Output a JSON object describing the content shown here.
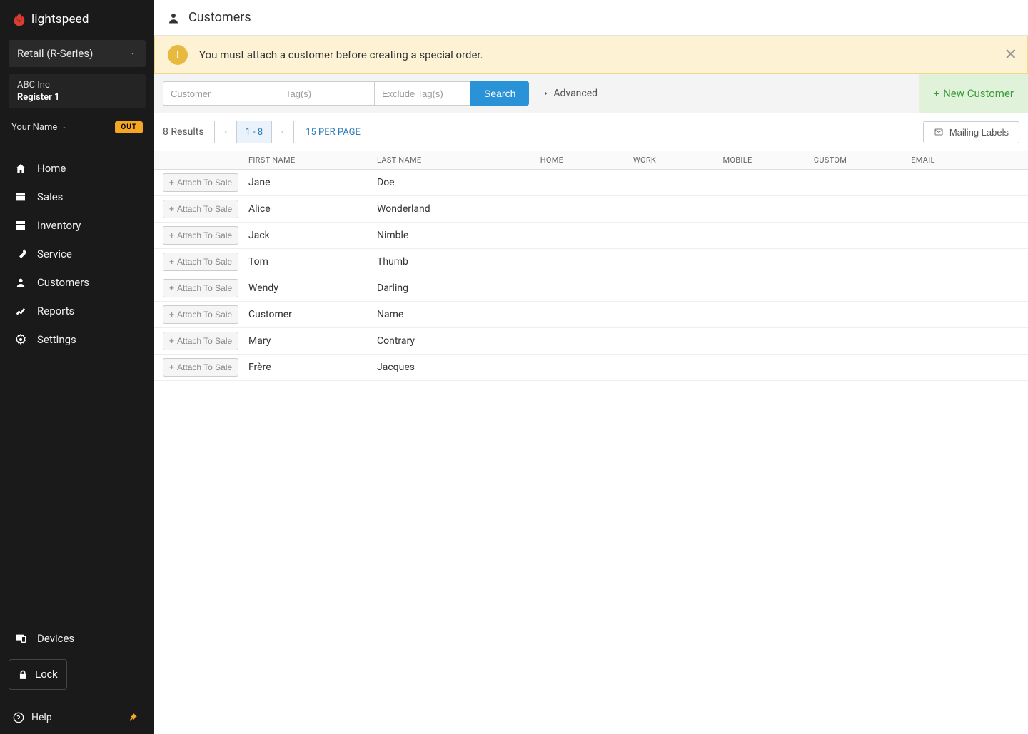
{
  "brand": "lightspeed",
  "sidebar": {
    "retail_label": "Retail (R-Series)",
    "company": "ABC Inc",
    "register": "Register 1",
    "user_name": "Your Name",
    "out_badge": "OUT",
    "nav": [
      {
        "label": "Home",
        "icon": "home"
      },
      {
        "label": "Sales",
        "icon": "sales"
      },
      {
        "label": "Inventory",
        "icon": "inventory"
      },
      {
        "label": "Service",
        "icon": "service"
      },
      {
        "label": "Customers",
        "icon": "customers"
      },
      {
        "label": "Reports",
        "icon": "reports"
      },
      {
        "label": "Settings",
        "icon": "settings"
      }
    ],
    "devices_label": "Devices",
    "lock_label": "Lock",
    "help_label": "Help"
  },
  "page": {
    "title": "Customers",
    "alert_text": "You must attach a customer before creating a special order."
  },
  "filters": {
    "customer_placeholder": "Customer",
    "tags_placeholder": "Tag(s)",
    "exclude_tags_placeholder": "Exclude Tag(s)",
    "search_label": "Search",
    "advanced_label": "Advanced",
    "new_customer_label": "New Customer"
  },
  "pagination": {
    "results_text": "8 Results",
    "range_text": "1 - 8",
    "per_page_text": "15 PER PAGE",
    "mailing_labels_text": "Mailing Labels"
  },
  "table": {
    "attach_label": "Attach To Sale",
    "columns": [
      "",
      "FIRST NAME",
      "LAST NAME",
      "HOME",
      "WORK",
      "MOBILE",
      "CUSTOM",
      "EMAIL"
    ],
    "rows": [
      {
        "first": "Jane",
        "last": "Doe"
      },
      {
        "first": "Alice",
        "last": "Wonderland"
      },
      {
        "first": "Jack",
        "last": "Nimble"
      },
      {
        "first": "Tom",
        "last": "Thumb"
      },
      {
        "first": "Wendy",
        "last": "Darling"
      },
      {
        "first": "Customer",
        "last": "Name"
      },
      {
        "first": "Mary",
        "last": "Contrary"
      },
      {
        "first": "Frère",
        "last": "Jacques"
      }
    ]
  }
}
